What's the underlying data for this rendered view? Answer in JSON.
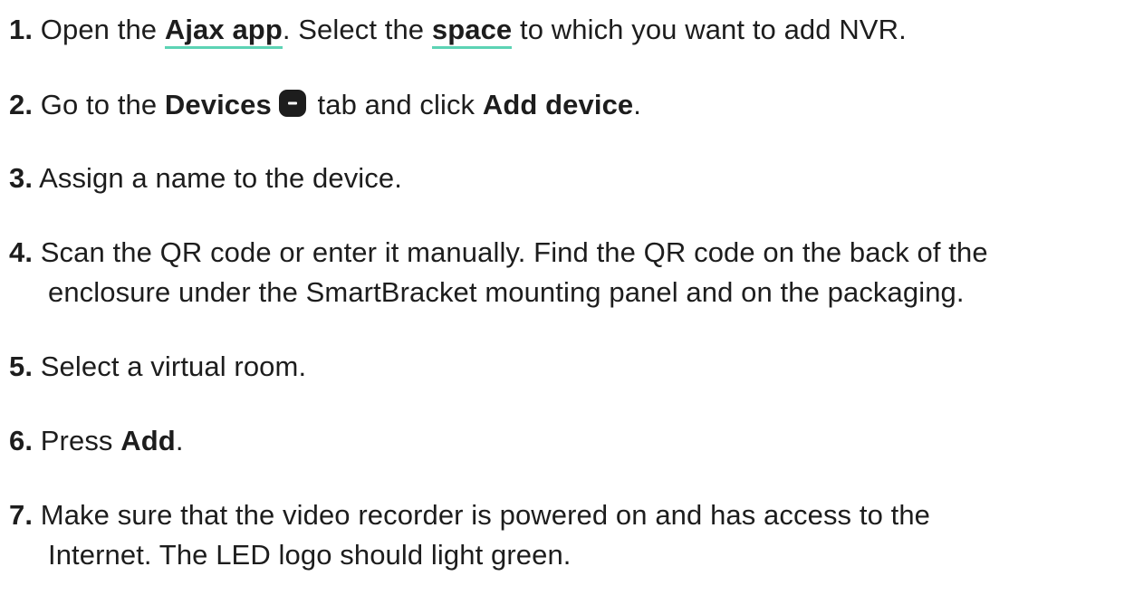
{
  "steps": [
    {
      "number": "1.",
      "t1": "Open the ",
      "link1": "Ajax app",
      "t2": ". Select the ",
      "link2": "space",
      "t3": " to which you want to add NVR."
    },
    {
      "number": "2.",
      "t1": "Go to the ",
      "b1": "Devices",
      "icon": "devices-tab-icon",
      "t2": " tab and click ",
      "b2": "Add device",
      "t3": "."
    },
    {
      "number": "3.",
      "text": "Assign a name to the device."
    },
    {
      "number": "4.",
      "line1": "Scan the QR code or enter it manually. Find the QR code on the back of the",
      "line2": "enclosure under the SmartBracket mounting panel and on the packaging."
    },
    {
      "number": "5.",
      "text": "Select a virtual room."
    },
    {
      "number": "6.",
      "t1": "Press ",
      "b1": "Add",
      "t2": "."
    },
    {
      "number": "7.",
      "line1": "Make sure that the video recorder is powered on and has access to the",
      "line2": "Internet. The LED logo should light green."
    }
  ],
  "colors": {
    "text": "#1d1d1d",
    "link_underline": "#5cd3b4",
    "icon_fill": "#1d1d1d"
  }
}
